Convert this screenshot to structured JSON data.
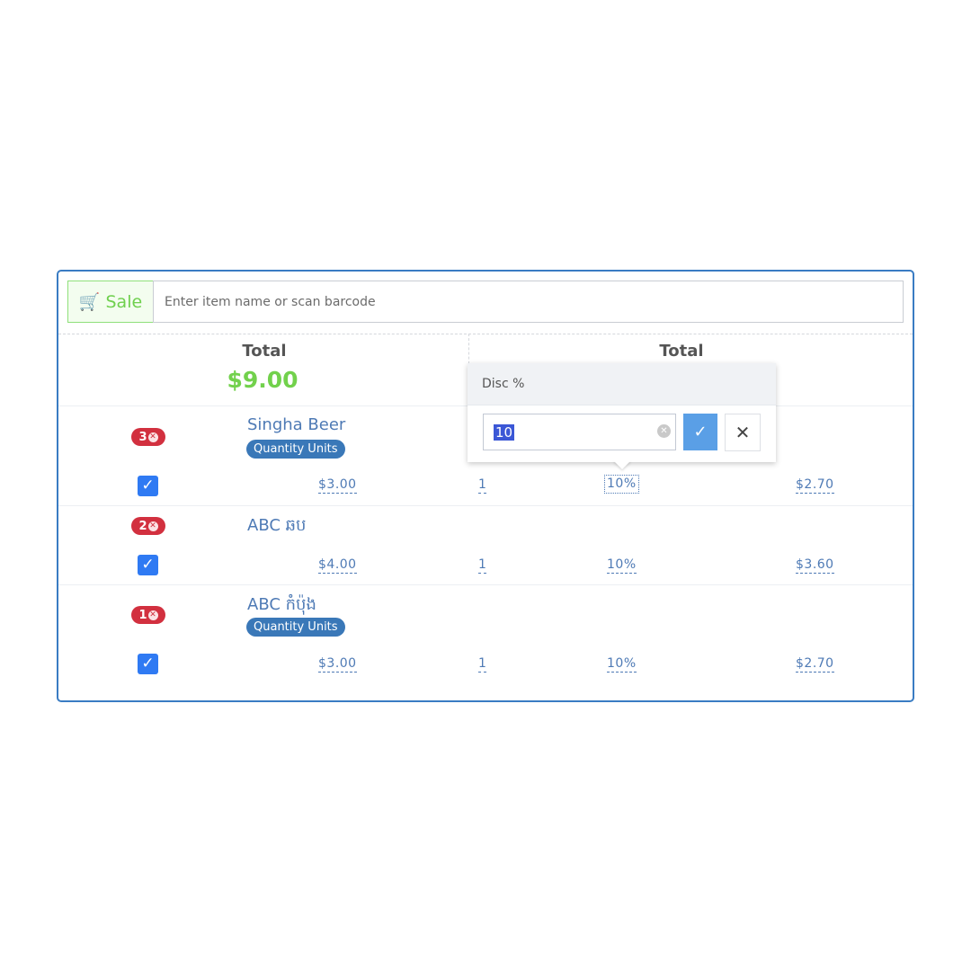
{
  "header": {
    "sale_label": "Sale",
    "sale_icon": "cart-icon",
    "search_placeholder": "Enter item name or scan barcode"
  },
  "summary": {
    "left_title": "Total",
    "grand_total": "$9.00",
    "right_title": "Total"
  },
  "items": [
    {
      "count": "3",
      "name": "Singha Beer",
      "tag": "Quantity Units",
      "checked": true,
      "price": "$3.00",
      "qty": "1",
      "disc": "10%",
      "total": "$2.70"
    },
    {
      "count": "2",
      "name": "ABC ឆប",
      "tag": "",
      "checked": true,
      "price": "$4.00",
      "qty": "1",
      "disc": "10%",
      "total": "$3.60"
    },
    {
      "count": "1",
      "name": "ABC កំប៉ុង",
      "tag": "Quantity Units",
      "checked": true,
      "price": "$3.00",
      "qty": "1",
      "disc": "10%",
      "total": "$2.70"
    }
  ],
  "popover": {
    "title": "Disc %",
    "value": "10"
  },
  "colors": {
    "accent": "#3a7cc3",
    "green": "#72d14c",
    "badge": "#d2303f",
    "checkbox": "#2f7af3",
    "confirm": "#5a9fe6"
  }
}
